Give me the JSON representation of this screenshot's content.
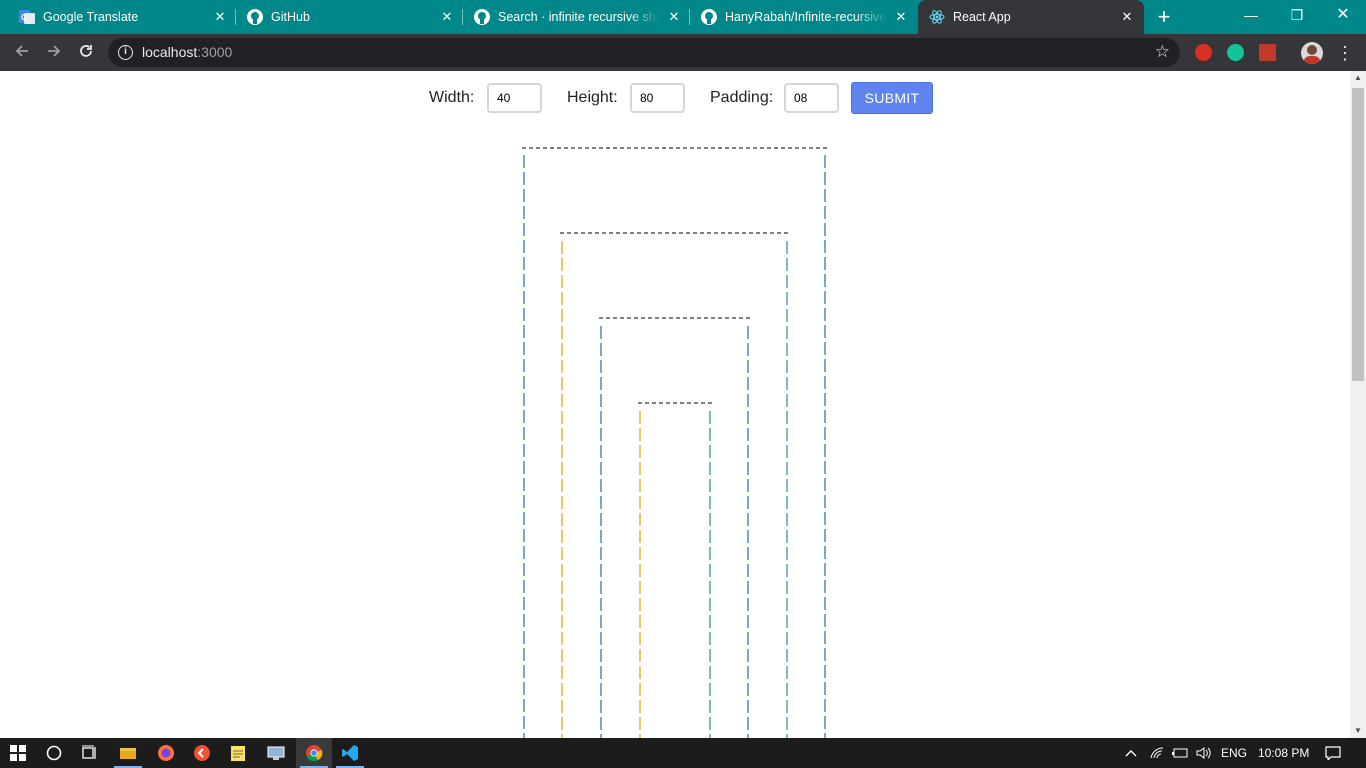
{
  "browser": {
    "tabs": [
      {
        "title": "Google Translate",
        "icon": "google-translate-icon"
      },
      {
        "title": "GitHub",
        "icon": "github-icon"
      },
      {
        "title": "Search · infinite recursive shape",
        "icon": "github-icon"
      },
      {
        "title": "HanyRabah/Infinite-recursive-s",
        "icon": "github-icon"
      },
      {
        "title": "React App",
        "icon": "react-icon"
      }
    ],
    "close_glyph": "✕",
    "new_tab_glyph": "+",
    "window_buttons": {
      "minimize": "—",
      "restore": "❐",
      "close": "✕"
    },
    "address": {
      "host": "localhost",
      "port": ":3000"
    },
    "accent": "#00878a"
  },
  "form": {
    "width_label": "Width:",
    "width_value": "40",
    "height_label": "Height:",
    "height_value": "80",
    "padding_label": "Padding:",
    "padding_value": "08",
    "submit_label": "SUBMIT",
    "submit_color": "#5f84f0"
  },
  "shape": {
    "description_width": 40,
    "description_height": 80,
    "description_padding": 8,
    "colors": {
      "dash": "#000000",
      "outer_bar": "#2a6aa8",
      "inner_bar": "#d6a400",
      "teal_bar": "#2a8a9a"
    }
  },
  "taskbar": {
    "language": "ENG",
    "time": "10:08 PM",
    "apps": [
      "windows-start-icon",
      "cortana-icon",
      "task-view-icon",
      "file-explorer-icon",
      "firefox-icon",
      "git-client-icon",
      "notes-icon",
      "network-tool-icon",
      "chrome-icon",
      "vscode-icon"
    ]
  }
}
